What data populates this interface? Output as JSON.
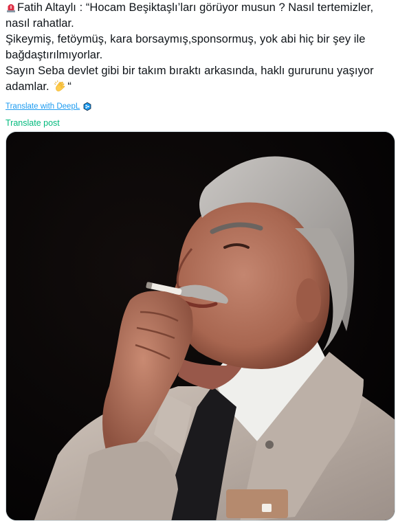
{
  "tweet": {
    "lines": [
      "Fatih Altaylı : “Hocam Beşiktaşlı’ları görüyor musun ? Nasıl tertemizler,",
      "nasıl rahatlar.",
      "Şikeymiş, fetöymüş, kara borsaymış,sponsormuş, yok abi hiç bir şey ile",
      "bağdaştırılmıyorlar.",
      "Sayın Seba devlet gibi bir takım bıraktı arkasında, haklı gururunu yaşıyor",
      "adamlar.",
      "“"
    ],
    "leading_emoji": "police-car-light",
    "trailing_emoji": "clapping-hands"
  },
  "translate": {
    "deepl_label": "Translate with DeepL",
    "post_label": "Translate post"
  },
  "colors": {
    "link_blue": "#1d9bf0",
    "translate_green": "#00ba7c",
    "text": "#0f1419"
  },
  "media": {
    "description_icon": "photo",
    "subject": "photo-of-man-smoking-cigarette"
  }
}
